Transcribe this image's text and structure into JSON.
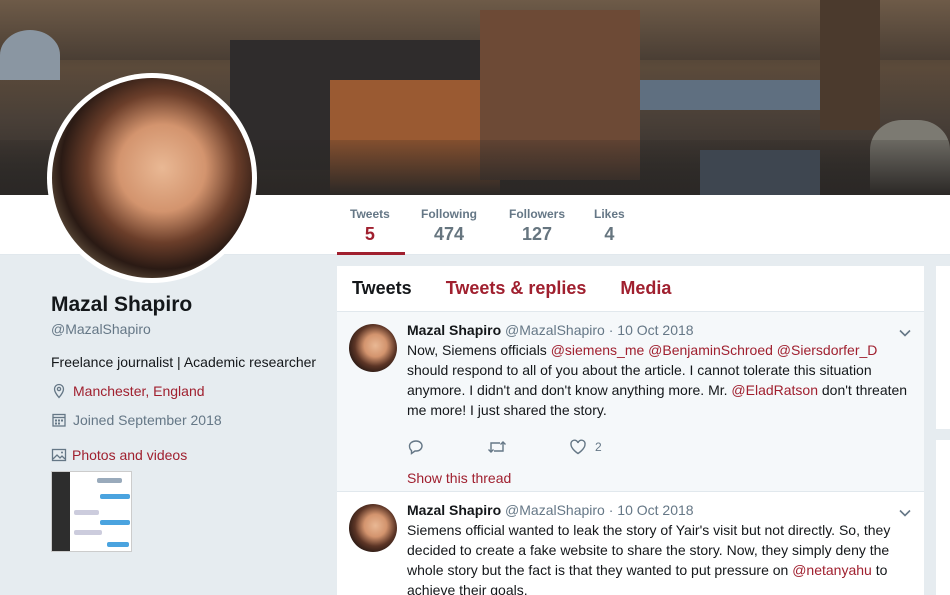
{
  "nav": {
    "stats": [
      {
        "label": "Tweets",
        "value": "5"
      },
      {
        "label": "Following",
        "value": "474"
      },
      {
        "label": "Followers",
        "value": "127"
      },
      {
        "label": "Likes",
        "value": "4"
      }
    ]
  },
  "profile": {
    "name": "Mazal Shapiro",
    "handle": "@MazalShapiro",
    "bio": "Freelance journalist | Academic researcher",
    "location": "Manchester, England",
    "joined": "Joined September 2018",
    "photos_label": "Photos and videos"
  },
  "tabs": [
    "Tweets",
    "Tweets & replies",
    "Media"
  ],
  "tweets": [
    {
      "name": "Mazal Shapiro",
      "handle": "@MazalShapiro",
      "date": "10 Oct 2018",
      "text_parts": [
        "Now, Siemens officials ",
        "@siemens_me",
        " ",
        "@BenjaminSchroed",
        " ",
        "@Siersdorfer_D",
        " should respond to all of you about the article. I cannot tolerate this situation anymore. I didn't and don't know anything more. Mr. ",
        "@EladRatson",
        " don't threaten me more! I just shared the story."
      ],
      "likes": "2",
      "show_thread": "Show this thread"
    },
    {
      "name": "Mazal Shapiro",
      "handle": "@MazalShapiro",
      "date": "10 Oct 2018",
      "text_parts": [
        "Siemens official wanted to leak the story of Yair's visit but not directly. So, they decided to create a fake website to share the story. Now, they simply deny the whole story but the fact is that they wanted to put pressure on ",
        "@netanyahu",
        " to achieve their goals."
      ]
    }
  ],
  "colors": {
    "accent": "#a0202f",
    "muted": "#657786",
    "background": "#e6ecf0"
  },
  "icons": [
    "location-icon",
    "calendar-icon",
    "image-icon",
    "reply-icon",
    "retweet-icon",
    "heart-icon",
    "chevron-down-icon"
  ]
}
